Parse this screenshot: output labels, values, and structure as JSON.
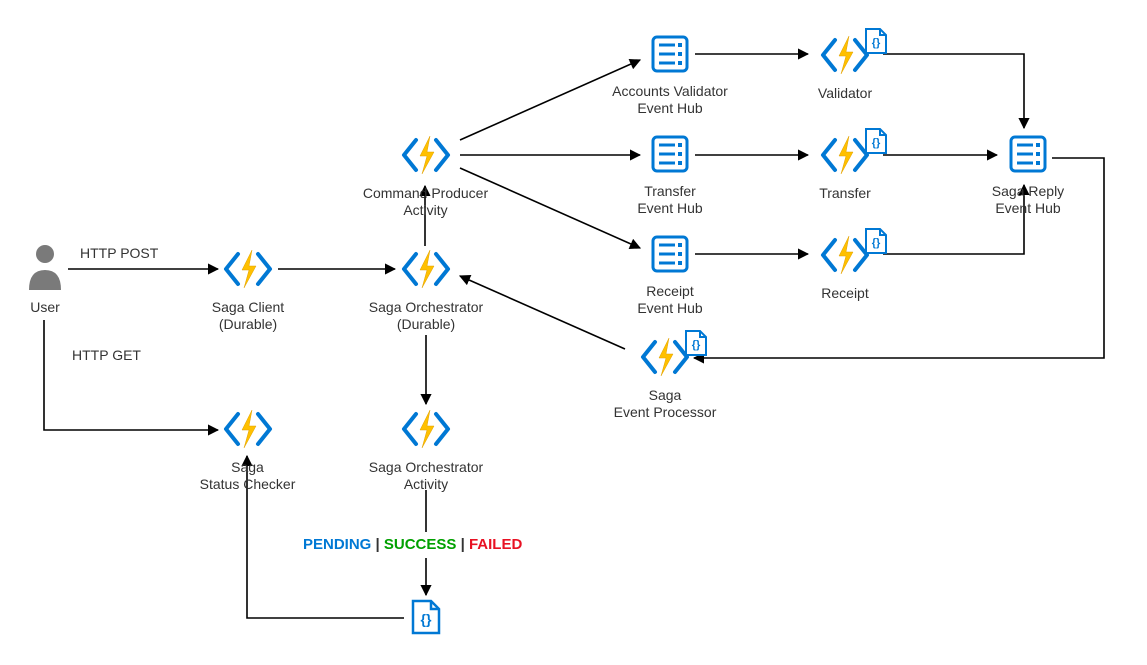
{
  "nodes": {
    "user": {
      "label": "User"
    },
    "saga_client": {
      "label": "Saga Client\n(Durable)"
    },
    "saga_orchestrator": {
      "label": "Saga Orchestrator\n(Durable)"
    },
    "command_producer_activity": {
      "label": "Command Producer\nActivity"
    },
    "saga_orchestrator_activity": {
      "label": "Saga Orchestrator\nActivity"
    },
    "saga_status_checker": {
      "label": "Saga\nStatus Checker"
    },
    "saga_event_processor": {
      "label": "Saga\nEvent Processor"
    },
    "accounts_validator_eh": {
      "label": "Accounts Validator\nEvent Hub"
    },
    "transfer_eh": {
      "label": "Transfer\nEvent Hub"
    },
    "receipt_eh": {
      "label": "Receipt\nEvent Hub"
    },
    "validator": {
      "label": "Validator"
    },
    "transfer_fn": {
      "label": "Transfer"
    },
    "receipt_fn": {
      "label": "Receipt"
    },
    "saga_reply_eh": {
      "label": "Saga Reply\nEvent Hub"
    }
  },
  "edges": {
    "http_post": {
      "label": "HTTP POST"
    },
    "http_get": {
      "label": "HTTP GET"
    }
  },
  "status": {
    "pending": {
      "text": "PENDING",
      "color": "#0078d4"
    },
    "success": {
      "text": "SUCCESS",
      "color": "#00a000"
    },
    "failed": {
      "text": "FAILED",
      "color": "#e81123"
    }
  },
  "colors": {
    "azure_blue": "#0078d4",
    "bolt_yellow": "#ffc000",
    "grey": "#7a7a7a"
  }
}
